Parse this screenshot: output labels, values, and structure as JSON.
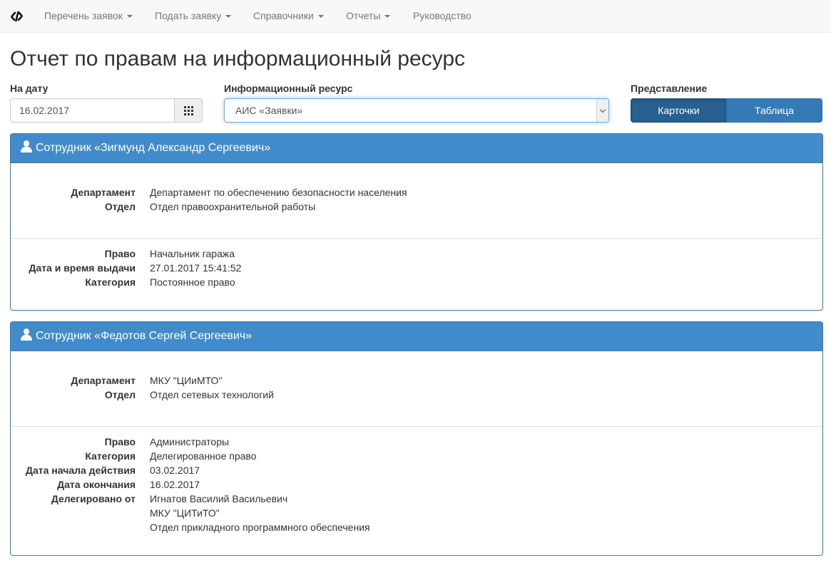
{
  "nav": {
    "items": [
      {
        "label": "Перечень заявок",
        "has_caret": true
      },
      {
        "label": "Подать заявку",
        "has_caret": true
      },
      {
        "label": "Справочники",
        "has_caret": true
      },
      {
        "label": "Отчеты",
        "has_caret": true
      },
      {
        "label": "Руководство",
        "has_caret": false
      }
    ],
    "brand_icon": "brand-logo-icon"
  },
  "page": {
    "title": "Отчет по правам на информационный ресурс"
  },
  "controls": {
    "date_label": "На дату",
    "date_value": "16.02.2017",
    "calendar_icon": "calendar-grid-icon",
    "resource_label": "Информационный ресурс",
    "resource_value": "АИС «Заявки»",
    "view_label": "Представление",
    "view_cards": "Карточки",
    "view_table": "Таблица",
    "view_selected": "Карточки"
  },
  "employees": [
    {
      "heading": "Сотрудник «Зигмунд Александр Сергеевич»",
      "org": [
        {
          "key": "Департамент",
          "value": "Департамент по обеспечению безопасности населения"
        },
        {
          "key": "Отдел",
          "value": "Отдел правоохранительной работы"
        }
      ],
      "rights": [
        {
          "key": "Право",
          "value": "Начальник гаража"
        },
        {
          "key": "Дата и время выдачи",
          "value": "27.01.2017 15:41:52"
        },
        {
          "key": "Категория",
          "value": "Постоянное право"
        }
      ]
    },
    {
      "heading": "Сотрудник «Федотов Сергей Сергеевич»",
      "org": [
        {
          "key": "Департамент",
          "value": "МКУ \"ЦИиМТО\""
        },
        {
          "key": "Отдел",
          "value": "Отдел сетевых технологий"
        }
      ],
      "rights": [
        {
          "key": "Право",
          "value": "Администраторы"
        },
        {
          "key": "Категория",
          "value": "Делегированное право"
        },
        {
          "key": "Дата начала действия",
          "value": "03.02.2017"
        },
        {
          "key": "Дата окончания",
          "value": "16.02.2017"
        },
        {
          "key": "Делегировано от",
          "value": "Игнатов Василий Васильевич"
        },
        {
          "key": "",
          "value": "МКУ \"ЦИТиТО\""
        },
        {
          "key": "",
          "value": "Отдел прикладного программного обеспечения"
        }
      ]
    }
  ],
  "colors": {
    "panel_heading": "#428bca",
    "panel_border": "#337ab7",
    "button_active": "#286090",
    "button": "#337ab7",
    "navbar": "#f8f8f8"
  }
}
